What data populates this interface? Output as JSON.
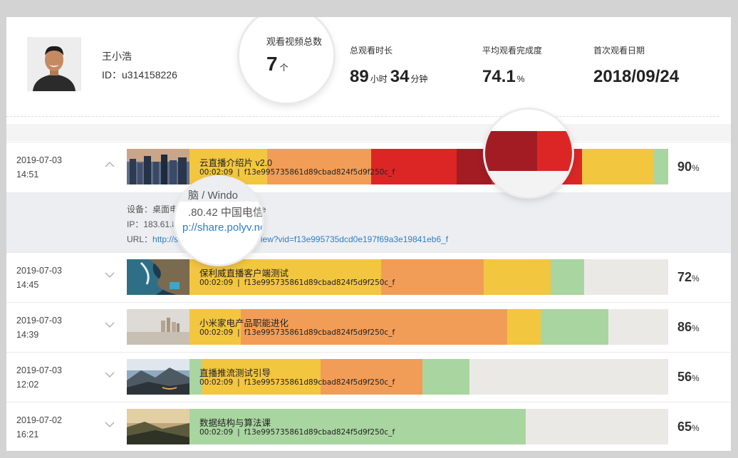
{
  "user": {
    "name": "王小浩",
    "id_text": "ID：u314158226"
  },
  "stats": {
    "total_videos": {
      "label": "观看视频总数",
      "value": "7",
      "unit": "个"
    },
    "total_time": {
      "label": "总观看时长",
      "hours": "89",
      "hours_unit": "小时",
      "minutes": "34",
      "minutes_unit": "分钟"
    },
    "avg_completion": {
      "label": "平均观看完成度",
      "value": "74.1",
      "unit": "%"
    },
    "first_date": {
      "label": "首次观看日期",
      "value": "2018/09/24"
    }
  },
  "detail": {
    "device_label": "设备：",
    "device_text": "桌面电脑 / Windows / Chrome",
    "ip_label": "IP：",
    "ip_text": "183.61.80.42  中国电信",
    "url_label": "URL：",
    "url_text": "http://share.polyv.net/video/view?vid=f13e995735dcd0e197f69a3e19841eb6_f",
    "zoom_lines": [
      "脑 / Windo",
      ".80.42  中国电信",
      "p://share.polyv.ne"
    ]
  },
  "heat_colors": {
    "gray": "#ebe9e6",
    "green": "#a9d5a0",
    "yellow": "#f3c640",
    "orange": "#f29d57",
    "red": "#dc2626",
    "darkred": "#a31c24"
  },
  "rows": [
    {
      "date": "2019-07-03",
      "time": "14:51",
      "expanded": true,
      "title": "云直播介绍片 v2.0",
      "duration": "00:02:09",
      "video_id": "f13e995735861d89cbad824f5d9f250c_f",
      "percent": "90",
      "percent_unit": "%",
      "segments": [
        {
          "color": "yellow",
          "fraction": 0.162
        },
        {
          "color": "orange",
          "fraction": 0.217
        },
        {
          "color": "red",
          "fraction": 0.179
        },
        {
          "color": "darkred",
          "fraction": 0.073
        },
        {
          "color": "red",
          "fraction": 0.189
        },
        {
          "color": "yellow",
          "fraction": 0.15
        },
        {
          "color": "green",
          "fraction": 0.03
        }
      ]
    },
    {
      "date": "2019-07-03",
      "time": "14:45",
      "expanded": false,
      "title": "保利威直播客户端测试",
      "duration": "00:02:09",
      "video_id": "f13e995735861d89cbad824f5d9f250c_f",
      "percent": "72",
      "percent_unit": "%",
      "segments": [
        {
          "color": "yellow",
          "fraction": 0.4
        },
        {
          "color": "orange",
          "fraction": 0.214
        },
        {
          "color": "yellow",
          "fraction": 0.14
        },
        {
          "color": "green",
          "fraction": 0.071
        }
      ]
    },
    {
      "date": "2019-07-03",
      "time": "14:39",
      "expanded": false,
      "title": "小米家电产品职能进化",
      "duration": "00:02:09",
      "video_id": "f13e995735861d89cbad824f5d9f250c_f",
      "percent": "86",
      "percent_unit": "%",
      "segments": [
        {
          "color": "yellow",
          "fraction": 0.107
        },
        {
          "color": "orange",
          "fraction": 0.557
        },
        {
          "color": "yellow",
          "fraction": 0.07
        },
        {
          "color": "green",
          "fraction": 0.141
        }
      ]
    },
    {
      "date": "2019-07-03",
      "time": "12:02",
      "expanded": false,
      "title": "直播推流测试引导",
      "duration": "00:02:09",
      "video_id": "f13e995735861d89cbad824f5d9f250c_f",
      "percent": "56",
      "percent_unit": "%",
      "segments": [
        {
          "color": "green",
          "fraction": 0.027
        },
        {
          "color": "yellow",
          "fraction": 0.247
        },
        {
          "color": "orange",
          "fraction": 0.213
        },
        {
          "color": "green",
          "fraction": 0.098
        }
      ]
    },
    {
      "date": "2019-07-02",
      "time": "16:21",
      "expanded": false,
      "title": "数据结构与算法课",
      "duration": "00:02:09",
      "video_id": "f13e995735861d89cbad824f5d9f250c_f",
      "percent": "65",
      "percent_unit": "%",
      "segments": [
        {
          "color": "green",
          "fraction": 0.702
        }
      ]
    }
  ]
}
